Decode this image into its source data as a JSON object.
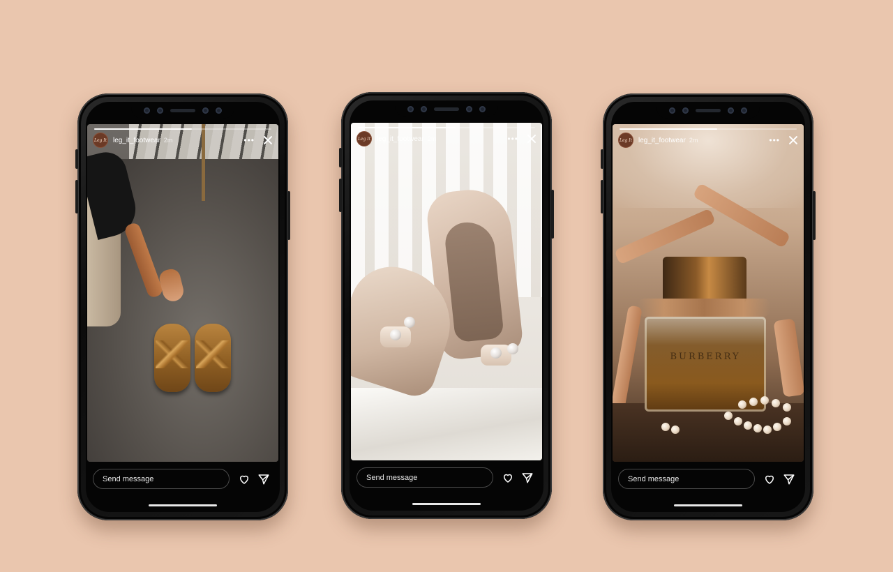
{
  "stories": [
    {
      "username": "leg_it_footwear",
      "time": "2m",
      "avatar_text": "Leg It",
      "more_label": "•••",
      "message_placeholder": "Send message",
      "progress": 0.55,
      "photo": "slippers-on-rug"
    },
    {
      "username": "leg_it_footwear",
      "time": "2m",
      "avatar_text": "Leg It",
      "more_label": "•••",
      "message_placeholder": "Send message",
      "progress": 0.55,
      "photo": "cream-bow-heels"
    },
    {
      "username": "leg_it_footwear",
      "time": "2m",
      "avatar_text": "Leg It",
      "more_label": "•••",
      "message_placeholder": "Send message",
      "progress": 0.55,
      "photo": "perfume-and-sandals",
      "bottle_label": "BURBERRY"
    }
  ],
  "icons": {
    "close": "close-icon",
    "more": "more-icon",
    "like": "heart-icon",
    "share": "send-icon"
  },
  "colors": {
    "background": "#eac6ae",
    "phone_frame": "#0c0c0c",
    "avatar": "#6b3a26"
  }
}
